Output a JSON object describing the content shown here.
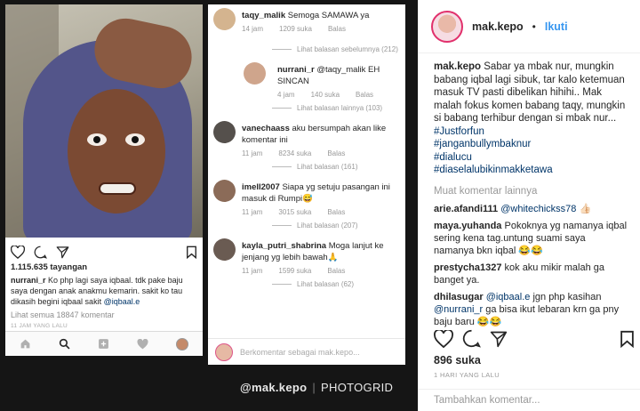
{
  "left_post": {
    "views": "1.115.635 tayangan",
    "caption_user": "nurrani_r",
    "caption_text": "Ko php lagi saya iqbaal. tdk pake baju saya dengan anak anakmu kemarin. sakit ko tau dikasih begini iqbaal sakit",
    "caption_mention": "@iqbaal.e",
    "view_all": "Lihat semua 18847 komentar",
    "date": "11 JAM YANG LALU"
  },
  "comments_screen": {
    "comments": [
      {
        "user": "taqy_malik",
        "text": "Semoga SAMAWA ya",
        "time": "14 jam",
        "likes": "1209 suka",
        "reply": "Balas"
      },
      {
        "more": "Lihat balasan sebelumnya (212)"
      },
      {
        "user": "nurrani_r",
        "text": "@taqy_malik EH SINCAN",
        "time": "4 jam",
        "likes": "140 suka",
        "reply": "Balas"
      },
      {
        "more": "Lihat balasan lainnya (103)"
      },
      {
        "user": "vanechaass",
        "text": "aku bersumpah akan like komentar ini",
        "time": "11 jam",
        "likes": "8234 suka",
        "reply": "Balas"
      },
      {
        "more": "Lihat balasan (161)"
      },
      {
        "user": "imell2007",
        "text": "Siapa yg setuju pasangan ini masuk di Rumpi😅",
        "time": "11 jam",
        "likes": "3015 suka",
        "reply": "Balas"
      },
      {
        "more": "Lihat balasan (207)"
      },
      {
        "user": "kayla_putri_shabrina",
        "text": "Moga lanjut ke jenjang yg lebih bawah🙏",
        "time": "11 jam",
        "likes": "1599 suka",
        "reply": "Balas"
      },
      {
        "more": "Lihat balasan (62)"
      }
    ],
    "add_comment_placeholder": "Berkomentar sebagai mak.kepo..."
  },
  "watermark": {
    "handle": "@mak.kepo",
    "app": "PHOTOGRID"
  },
  "panel": {
    "username": "mak.kepo",
    "dot": "•",
    "follow": "Ikuti",
    "caption_user": "mak.kepo",
    "caption": "Sabar ya mbak nur, mungkin babang iqbal lagi sibuk, tar kalo ketemuan masuk TV pasti dibelikan hihihi.. Mak malah fokus komen babang taqy, mungkin si babang terhibur dengan si mbak nur...",
    "hashtags": [
      "#Justforfun",
      "#janganbullymbaknur",
      "#dialucu",
      "#diaselalubikinmakketawa"
    ],
    "load_more": "Muat komentar lainnya",
    "comments": [
      {
        "user": "arie.afandi111",
        "mention": "@whitechickss78",
        "text": "👍🏻"
      },
      {
        "user": "maya.yuhanda",
        "mention": "",
        "text": "Pokoknya yg namanya iqbal sering kena tag.untung suami saya namanya bkn iqbal 😂😂"
      },
      {
        "user": "prestycha1327",
        "mention": "",
        "text": "kok aku mikir malah ga banget ya."
      },
      {
        "user": "dhilasugar",
        "mention": "@iqbaal.e",
        "text": "jgn php kasihan",
        "mention2": "@nurrani_r",
        "text2": "ga bisa ikut lebaran krn ga pny baju baru 😂😂"
      }
    ],
    "likes": "896 suka",
    "time_ago": "1 HARI YANG LALU",
    "add_comment_placeholder": "Tambahkan komentar..."
  }
}
